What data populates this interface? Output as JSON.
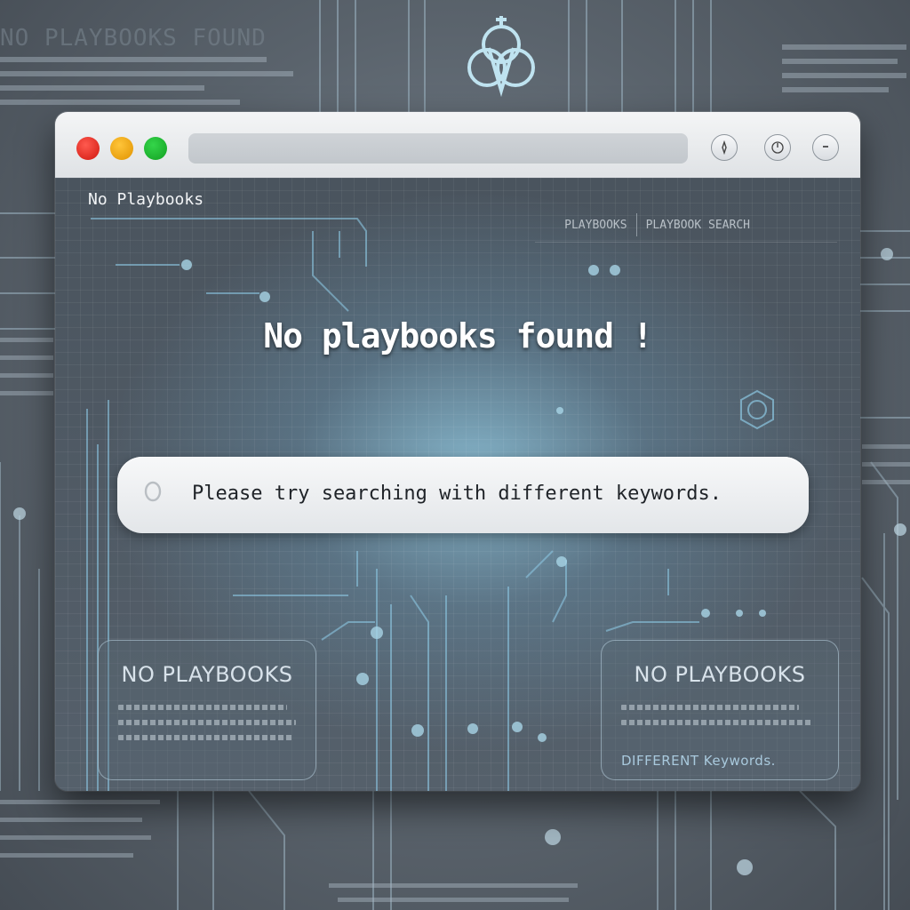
{
  "background": {
    "heading": "NO PLAYBOOKS FOUND",
    "emblem_icon": "biohazard-icon"
  },
  "window": {
    "controls": [
      "close",
      "minimize",
      "zoom"
    ],
    "toolbar_icons": [
      "compass-icon",
      "clock-icon",
      "dropdown-icon"
    ]
  },
  "page": {
    "title": "No Playbooks",
    "nav": [
      "PLAYBOOKS",
      "PLAYBOOK SEARCH"
    ],
    "headline": "No playbooks found !",
    "search_message": "Please try searching with different keywords."
  },
  "cards": {
    "left_title": "NO PLAYBOOKS",
    "right_title": "NO PLAYBOOKS",
    "right_footer": "DIFFERENT Keywords."
  },
  "colors": {
    "accent": "#8fd3f0",
    "close": "#e8251c",
    "minimize": "#f2a90f",
    "zoom": "#1fb52f"
  }
}
